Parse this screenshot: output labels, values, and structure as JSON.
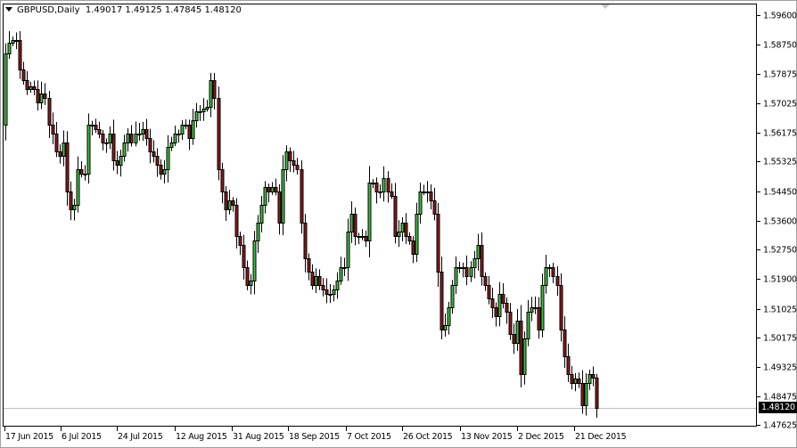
{
  "header": {
    "symbol_timeframe": "GBPUSD,Daily",
    "ohlc": "1.49017 1.49125 1.47845 1.48120"
  },
  "colors": {
    "bull": "#3fbf3f",
    "bear": "#8b1a1a",
    "wick": "#000000",
    "price_line": "#c0c0c0"
  },
  "chart_data": {
    "type": "candlestick",
    "title": "GBPUSD,Daily",
    "ylim": [
      1.4761,
      1.5991
    ],
    "yticks": [
      "1.59600",
      "1.58750",
      "1.57875",
      "1.57025",
      "1.56175",
      "1.55325",
      "1.54450",
      "1.53600",
      "1.52750",
      "1.51900",
      "1.51025",
      "1.50175",
      "1.49325",
      "1.48475",
      "1.47625"
    ],
    "xticks": [
      "17 Jun 2015",
      "6 Jul 2015",
      "24 Jul 2015",
      "12 Aug 2015",
      "31 Aug 2015",
      "18 Sep 2015",
      "7 Oct 2015",
      "26 Oct 2015",
      "13 Nov 2015",
      "2 Dec 2015",
      "21 Dec 2015"
    ],
    "current_price": "1.48120",
    "first_open": 1.564,
    "last_candle": {
      "open": 1.49017,
      "high": 1.49125,
      "low": 1.47845,
      "close": 1.4812
    },
    "closes": [
      1.5848,
      1.5879,
      1.5887,
      1.5887,
      1.5801,
      1.577,
      1.5744,
      1.5752,
      1.5744,
      1.5705,
      1.5731,
      1.5718,
      1.564,
      1.5614,
      1.5562,
      1.5549,
      1.5588,
      1.5445,
      1.5393,
      1.5406,
      1.551,
      1.5497,
      1.5497,
      1.564,
      1.564,
      1.5627,
      1.5614,
      1.5588,
      1.5588,
      1.5614,
      1.5536,
      1.5523,
      1.5549,
      1.5588,
      1.5614,
      1.5588,
      1.5614,
      1.5614,
      1.5627,
      1.5601,
      1.5562,
      1.5549,
      1.5523,
      1.5497,
      1.551,
      1.5575,
      1.5588,
      1.5614,
      1.5614,
      1.564,
      1.564,
      1.5601,
      1.5653,
      1.5679,
      1.5679,
      1.5687,
      1.5692,
      1.577,
      1.5718,
      1.551,
      1.5445,
      1.5393,
      1.5419,
      1.5406,
      1.5315,
      1.5289,
      1.5224,
      1.5172,
      1.5185,
      1.5302,
      1.5354,
      1.5406,
      1.5458,
      1.5445,
      1.5458,
      1.5445,
      1.5354,
      1.551,
      1.5562,
      1.5536,
      1.5523,
      1.551,
      1.5354,
      1.525,
      1.5211,
      1.5172,
      1.5198,
      1.5172,
      1.5159,
      1.5146,
      1.5146,
      1.5159,
      1.5185,
      1.5224,
      1.5224,
      1.5328,
      1.538,
      1.5315,
      1.5315,
      1.5315,
      1.5302,
      1.5471,
      1.5471,
      1.5445,
      1.5445,
      1.5484,
      1.5445,
      1.5432,
      1.5315,
      1.5328,
      1.5354,
      1.5315,
      1.5302,
      1.5263,
      1.538,
      1.5445,
      1.5445,
      1.5445,
      1.5419,
      1.538,
      1.5211,
      1.5042,
      1.5055,
      1.5107,
      1.5172,
      1.5224,
      1.5224,
      1.5224,
      1.5198,
      1.5224,
      1.525,
      1.5289,
      1.5198,
      1.5172,
      1.5133,
      1.5107,
      1.5081,
      1.5146,
      1.512,
      1.5094,
      1.5029,
      1.5003,
      1.5068,
      1.4912,
      1.5016,
      1.5094,
      1.5107,
      1.5107,
      1.5042,
      1.5172,
      1.5224,
      1.5224,
      1.5198,
      1.5172,
      1.5042,
      1.4964,
      1.4912,
      1.4886,
      1.4899,
      1.4886,
      1.4821,
      1.4886,
      1.4912,
      1.4902
    ]
  }
}
